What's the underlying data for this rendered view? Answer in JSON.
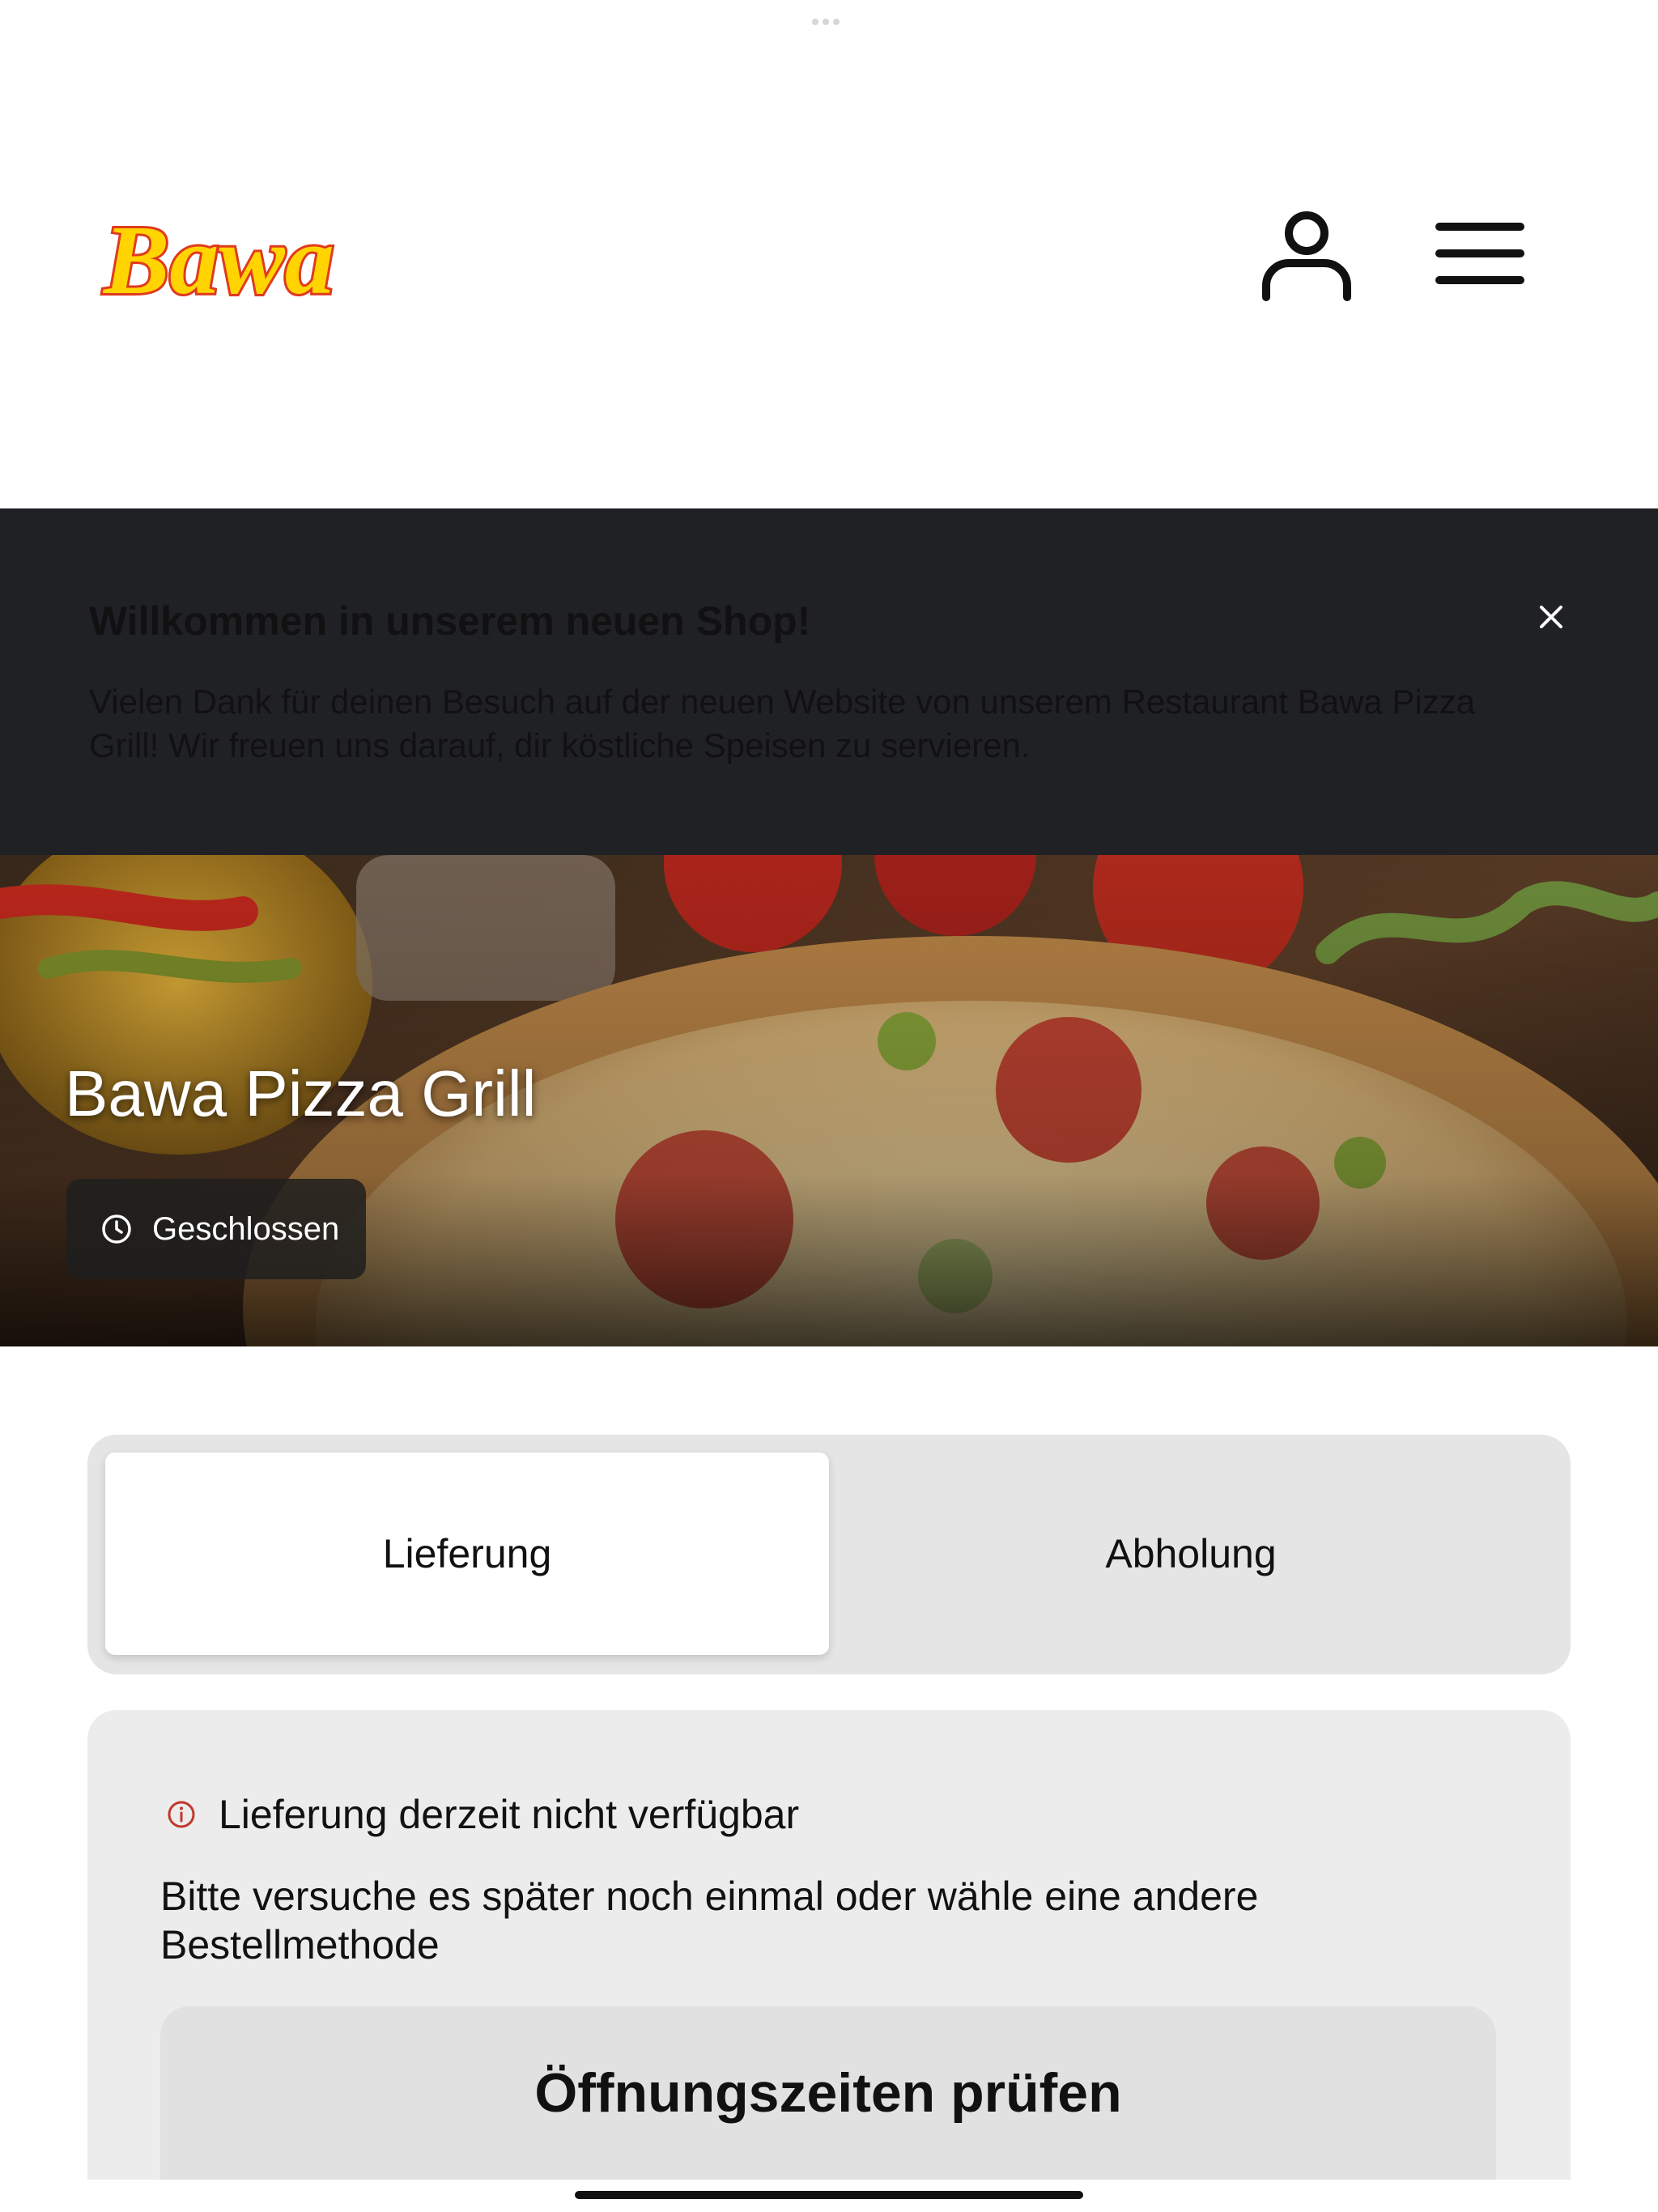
{
  "header": {
    "logo_text": "Bawa",
    "colors": {
      "logo_fill": "#FFD400",
      "logo_outline": "#E03A1E"
    },
    "icons": {
      "account": "user-icon",
      "menu": "menu-icon"
    }
  },
  "banner": {
    "title": "Willkommen in unserem neuen Shop!",
    "text": "Vielen Dank für deinen Besuch auf der neuen Website von unserem Restaurant Bawa Pizza Grill! Wir freuen uns darauf, dir köstliche Speisen zu servieren.",
    "close_icon": "close-icon",
    "background": "#202125"
  },
  "hero": {
    "restaurant_name": "Bawa Pizza Grill",
    "status_label": "Geschlossen",
    "status_icon": "clock-icon"
  },
  "order_method": {
    "tabs": [
      {
        "label": "Lieferung",
        "active": true
      },
      {
        "label": "Abholung",
        "active": false
      }
    ]
  },
  "notice": {
    "title": "Lieferung derzeit nicht verfügbar",
    "text": "Bitte versuche es später noch einmal oder wähle eine andere Bestellmethode",
    "button_label": "Öffnungszeiten prüfen",
    "info_icon": "info-icon",
    "accent": "#C0392B"
  }
}
